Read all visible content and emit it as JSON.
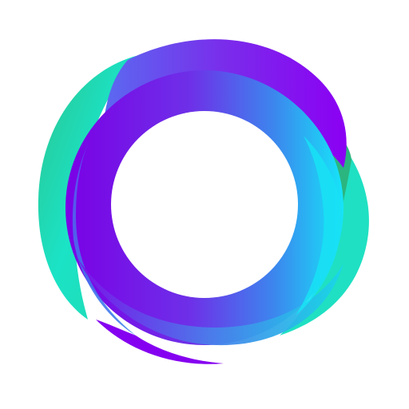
{
  "canvas": {
    "background": "#ffffff"
  },
  "logo": {
    "icon_name": "swirl-ring-logo-icon",
    "colors": {
      "teal": "#19E0C0",
      "green_teal": "#2DB88F",
      "purple": "#8A00F2",
      "violet": "#6A2BE6",
      "blue": "#3D7DEB",
      "cyan": "#18E2F6",
      "center": "#ffffff"
    }
  }
}
